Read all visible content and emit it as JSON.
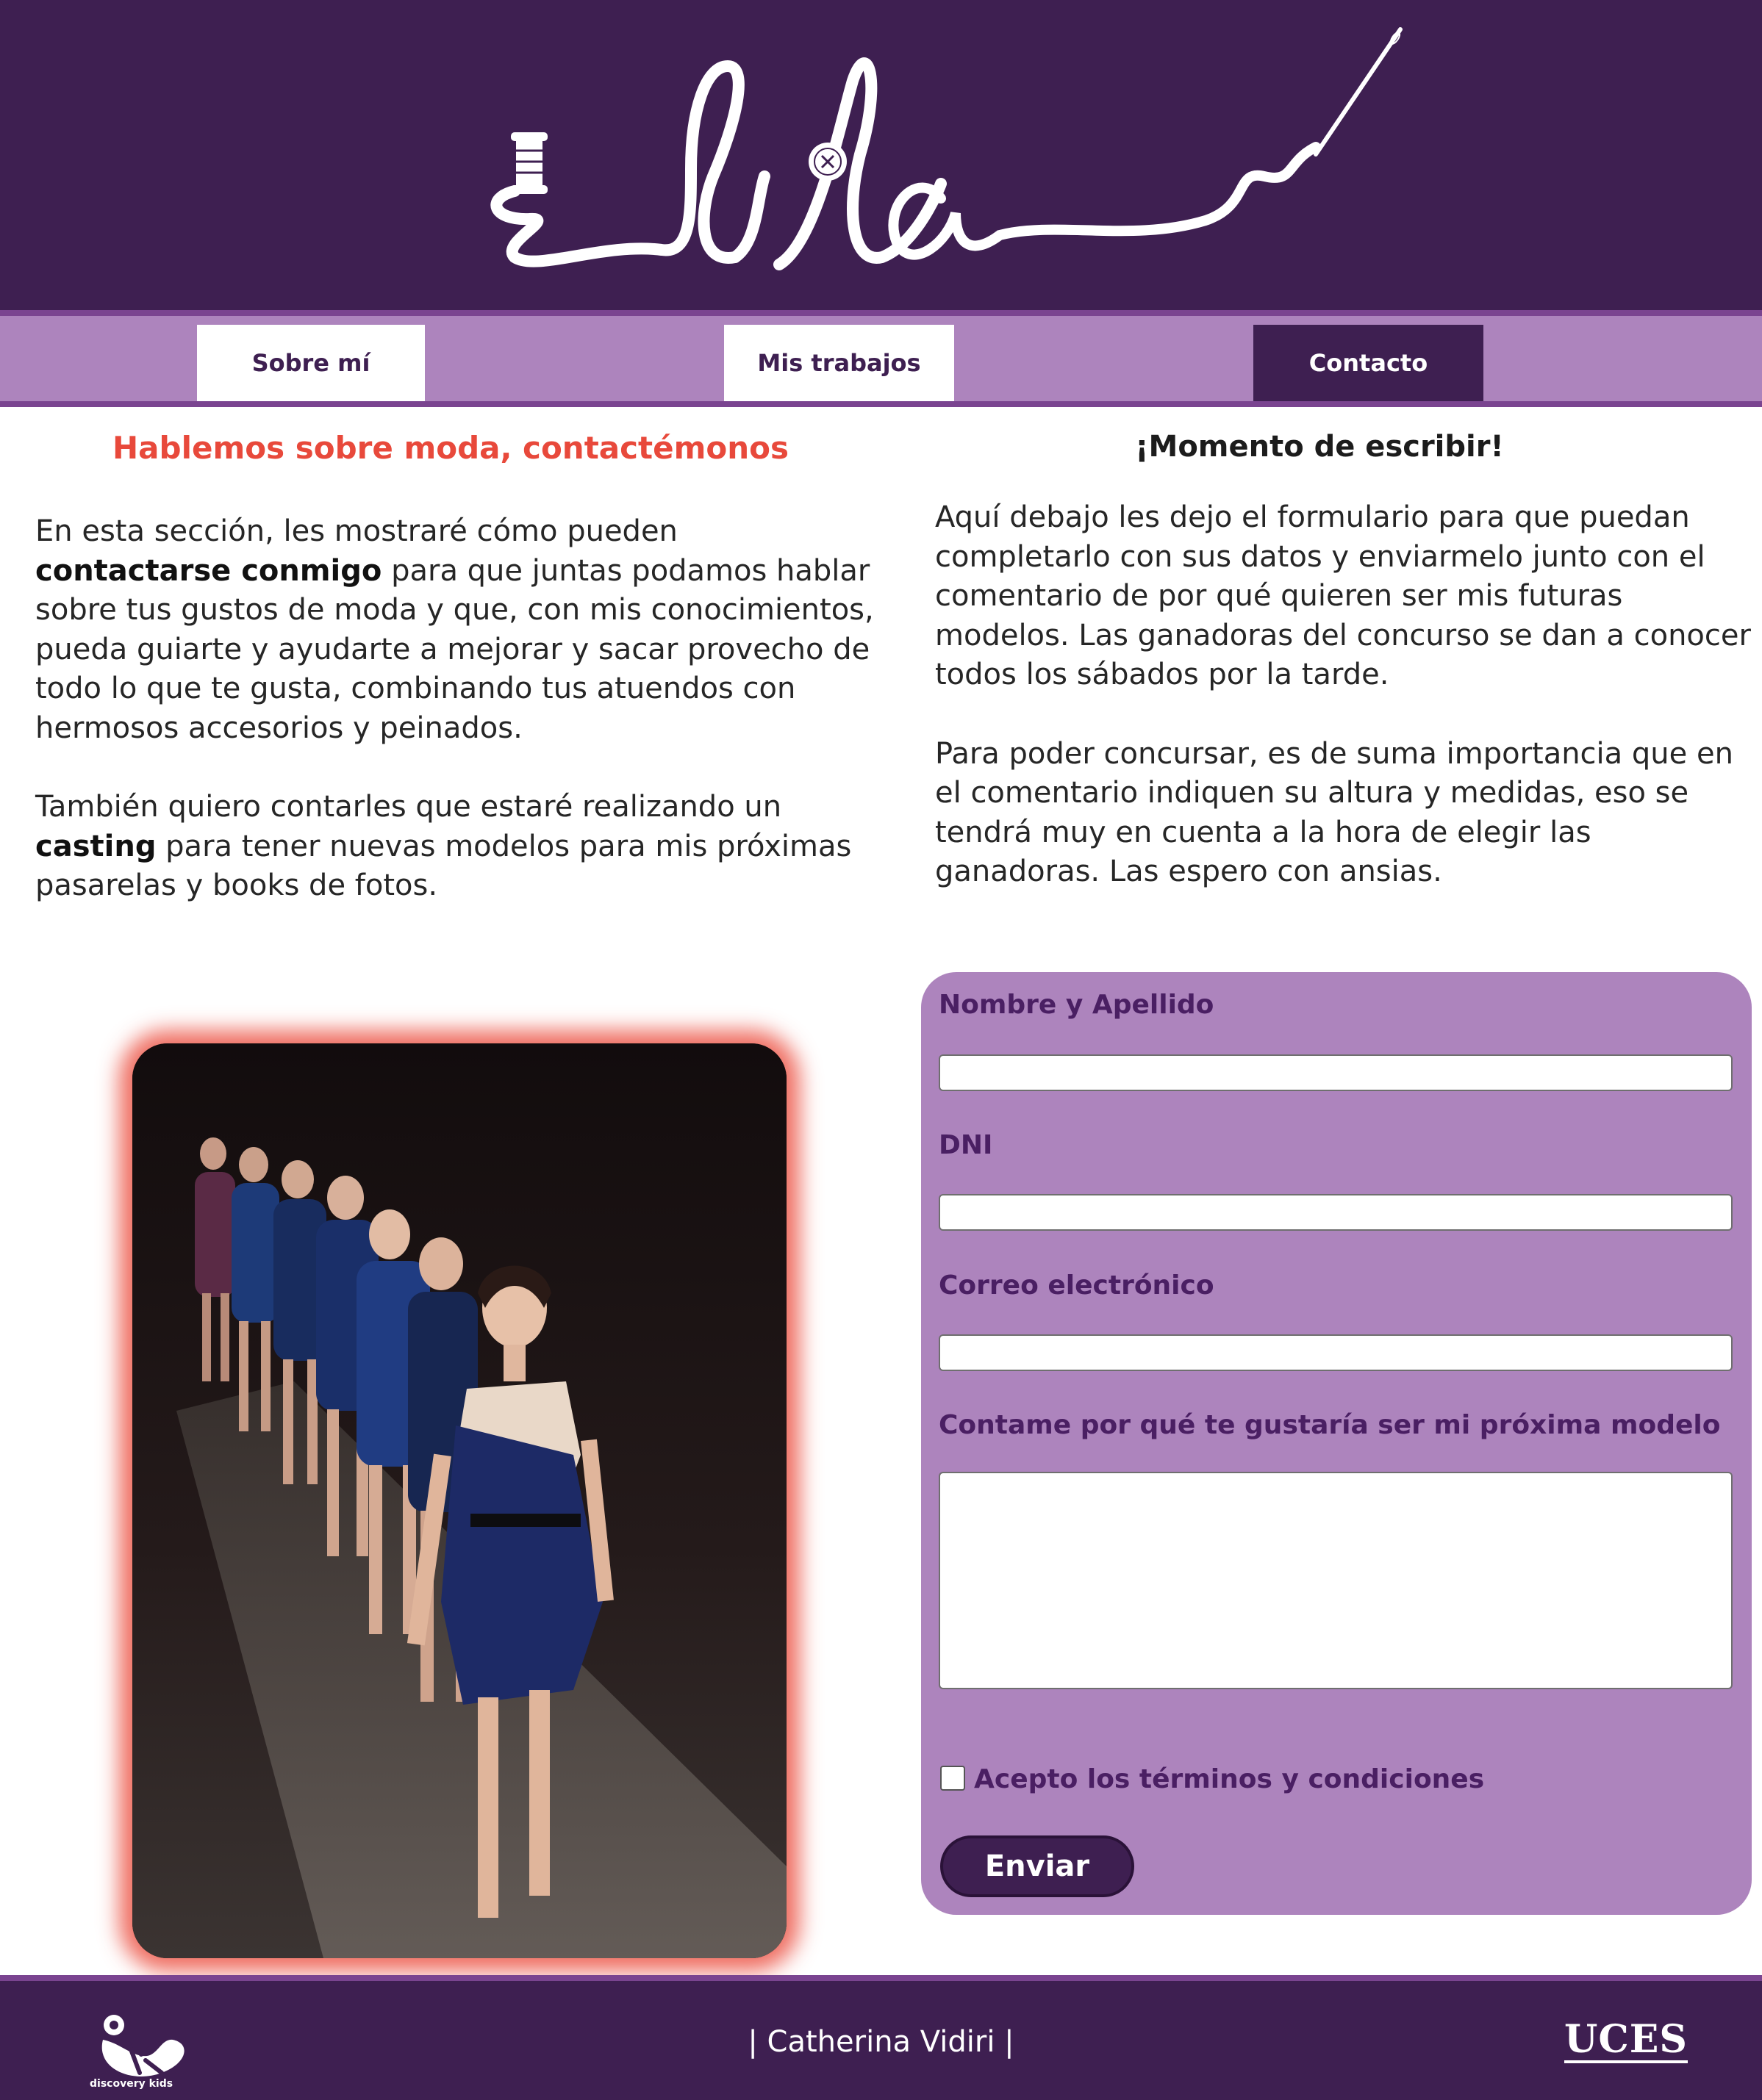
{
  "header": {
    "logo_text": "lila"
  },
  "nav": {
    "items": [
      {
        "label": "Sobre mí"
      },
      {
        "label": "Mis trabajos"
      },
      {
        "label": "Contacto"
      }
    ]
  },
  "left": {
    "title": "Hablemos sobre moda, contactémonos",
    "p1_a": "En esta sección, les mostraré cómo pueden ",
    "p1_b": "contactarse conmigo",
    "p1_c": " para que juntas podamos hablar sobre tus gustos de moda y que, con mis conocimientos, pueda guiarte y ayudarte a mejorar y sacar provecho de todo lo que te gusta, combinando tus atuendos con hermosos accesorios y peinados.",
    "p2_a": "También quiero contarles que estaré realizando un ",
    "p2_b": "casting",
    "p2_c": " para tener nuevas modelos para mis próximas pasarelas y books de fotos."
  },
  "right": {
    "title": "¡Momento de escribir!",
    "p1": "Aquí debajo les dejo el formulario para que puedan completarlo con sus datos y enviarmelo junto con el comentario de por qué quieren ser mis futuras modelos. Las ganadoras del concurso se dan a conocer todos los sábados por la tarde.",
    "p2": "Para poder concursar, es de suma importancia que en el comentario indiquen su altura y medidas, eso se tendrá muy en cuenta a la hora de elegir las ganadoras. Las espero con ansias."
  },
  "form": {
    "name_label": "Nombre y Apellido",
    "name_value": "",
    "dni_label": "DNI",
    "dni_value": "",
    "email_label": "Correo electrónico",
    "email_value": "",
    "comment_label": "Contame por qué te gustaría ser mi próxima modelo",
    "comment_value": "",
    "terms_label": "Acepto los términos y condiciones",
    "submit_label": "Enviar"
  },
  "footer": {
    "author": "| Catherina Vidiri |",
    "left_logo_caption": "discovery kids",
    "right_logo": "UCES"
  },
  "colors": {
    "header_bg": "#3e1f51",
    "nav_bg": "#ad84bd",
    "accent_red": "#e8493b",
    "form_bg": "#ad84bd",
    "label_purple": "#4a1f63"
  }
}
